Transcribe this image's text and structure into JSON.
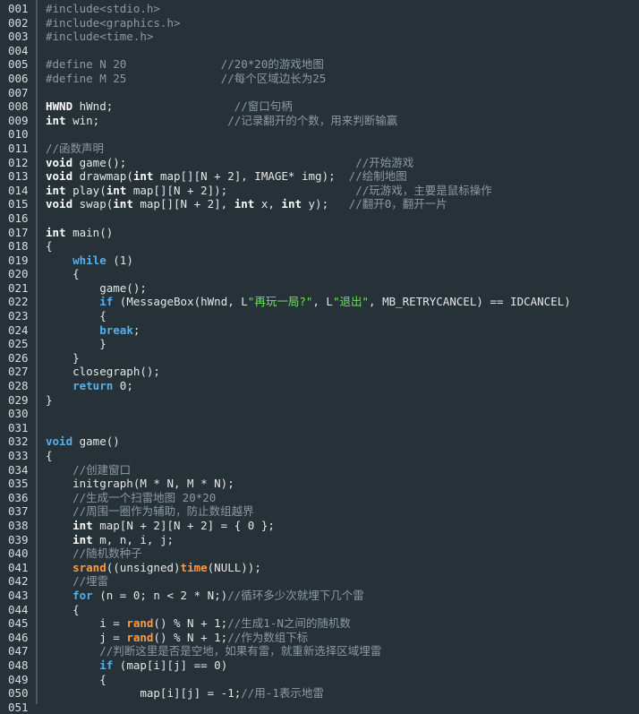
{
  "editor": {
    "background": "#263238",
    "colors": {
      "default": "#e6e6e6",
      "keyword": "#ffffff",
      "control_keyword": "#53b0ef",
      "function": "#ff9a3c",
      "comment": "#8c9a9f",
      "string": "#6fe05c",
      "line_number": "#d8dee0"
    },
    "lines": [
      {
        "num": "001",
        "tokens": [
          [
            "pre",
            "#include<stdio.h>"
          ]
        ]
      },
      {
        "num": "002",
        "tokens": [
          [
            "pre",
            "#include<graphics.h>"
          ]
        ]
      },
      {
        "num": "003",
        "tokens": [
          [
            "pre",
            "#include<time.h>"
          ]
        ]
      },
      {
        "num": "004",
        "tokens": []
      },
      {
        "num": "005",
        "tokens": [
          [
            "pre",
            "#define N 20              "
          ],
          [
            "com",
            "//20*20的游戏地图"
          ]
        ]
      },
      {
        "num": "006",
        "tokens": [
          [
            "pre",
            "#define M 25              "
          ],
          [
            "com",
            "//每个区域边长为25"
          ]
        ]
      },
      {
        "num": "007",
        "tokens": []
      },
      {
        "num": "008",
        "tokens": [
          [
            "kw",
            "HWND"
          ],
          [
            "default",
            " hWnd;                  "
          ],
          [
            "com",
            "//窗口句柄"
          ]
        ]
      },
      {
        "num": "009",
        "tokens": [
          [
            "kw",
            "int"
          ],
          [
            "default",
            " win;                   "
          ],
          [
            "com",
            "//记录翻开的个数，用来判断输赢"
          ]
        ]
      },
      {
        "num": "010",
        "tokens": []
      },
      {
        "num": "011",
        "tokens": [
          [
            "com",
            "//函数声明"
          ]
        ]
      },
      {
        "num": "012",
        "tokens": [
          [
            "kw",
            "void"
          ],
          [
            "default",
            " game();                                  "
          ],
          [
            "com",
            "//开始游戏"
          ]
        ]
      },
      {
        "num": "013",
        "tokens": [
          [
            "kw",
            "void"
          ],
          [
            "default",
            " drawmap("
          ],
          [
            "kw",
            "int"
          ],
          [
            "default",
            " map[][N + 2], IMAGE* img);  "
          ],
          [
            "com",
            "//绘制地图"
          ]
        ]
      },
      {
        "num": "014",
        "tokens": [
          [
            "kw",
            "int"
          ],
          [
            "default",
            " play("
          ],
          [
            "kw",
            "int"
          ],
          [
            "default",
            " map[][N + 2]);                   "
          ],
          [
            "com",
            "//玩游戏，主要是鼠标操作"
          ]
        ]
      },
      {
        "num": "015",
        "tokens": [
          [
            "kw",
            "void"
          ],
          [
            "default",
            " swap("
          ],
          [
            "kw",
            "int"
          ],
          [
            "default",
            " map[][N + 2], "
          ],
          [
            "kw",
            "int"
          ],
          [
            "default",
            " x, "
          ],
          [
            "kw",
            "int"
          ],
          [
            "default",
            " y);   "
          ],
          [
            "com",
            "//翻开0，翻开一片"
          ]
        ]
      },
      {
        "num": "016",
        "tokens": []
      },
      {
        "num": "017",
        "tokens": [
          [
            "kw",
            "int"
          ],
          [
            "default",
            " main()"
          ]
        ]
      },
      {
        "num": "018",
        "tokens": [
          [
            "default",
            "{"
          ]
        ]
      },
      {
        "num": "019",
        "tokens": [
          [
            "default",
            "    "
          ],
          [
            "kw2",
            "while"
          ],
          [
            "default",
            " (1)"
          ]
        ]
      },
      {
        "num": "020",
        "tokens": [
          [
            "default",
            "    {"
          ]
        ]
      },
      {
        "num": "021",
        "tokens": [
          [
            "default",
            "        game();"
          ]
        ]
      },
      {
        "num": "022",
        "tokens": [
          [
            "default",
            "        "
          ],
          [
            "kw2",
            "if"
          ],
          [
            "default",
            " (MessageBox(hWnd, L"
          ],
          [
            "str",
            "\"再玩一局?\""
          ],
          [
            "default",
            ", L"
          ],
          [
            "str",
            "\"退出\""
          ],
          [
            "default",
            ", MB_RETRYCANCEL) == IDCANCEL)"
          ]
        ]
      },
      {
        "num": "023",
        "tokens": [
          [
            "default",
            "        {"
          ]
        ]
      },
      {
        "num": "024",
        "tokens": [
          [
            "default",
            "        "
          ],
          [
            "kw2",
            "break"
          ],
          [
            "default",
            ";"
          ]
        ]
      },
      {
        "num": "025",
        "tokens": [
          [
            "default",
            "        }"
          ]
        ]
      },
      {
        "num": "026",
        "tokens": [
          [
            "default",
            "    }"
          ]
        ]
      },
      {
        "num": "027",
        "tokens": [
          [
            "default",
            "    closegraph();"
          ]
        ]
      },
      {
        "num": "028",
        "tokens": [
          [
            "default",
            "    "
          ],
          [
            "kw2",
            "return"
          ],
          [
            "default",
            " 0;"
          ]
        ]
      },
      {
        "num": "029",
        "tokens": [
          [
            "default",
            "}"
          ]
        ]
      },
      {
        "num": "030",
        "tokens": []
      },
      {
        "num": "031",
        "tokens": []
      },
      {
        "num": "032",
        "tokens": [
          [
            "kw2",
            "void"
          ],
          [
            "default",
            " game()"
          ]
        ]
      },
      {
        "num": "033",
        "tokens": [
          [
            "default",
            "{"
          ]
        ]
      },
      {
        "num": "034",
        "tokens": [
          [
            "default",
            "    "
          ],
          [
            "com",
            "//创建窗口"
          ]
        ]
      },
      {
        "num": "035",
        "tokens": [
          [
            "default",
            "    initgraph(M * N, M * N);"
          ]
        ]
      },
      {
        "num": "036",
        "tokens": [
          [
            "default",
            "    "
          ],
          [
            "com",
            "//生成一个扫雷地图 20*20"
          ]
        ]
      },
      {
        "num": "037",
        "tokens": [
          [
            "default",
            "    "
          ],
          [
            "com",
            "//周围一圈作为辅助，防止数组越界"
          ]
        ]
      },
      {
        "num": "038",
        "tokens": [
          [
            "default",
            "    "
          ],
          [
            "kw",
            "int"
          ],
          [
            "default",
            " map[N + 2][N + 2] = { 0 };"
          ]
        ]
      },
      {
        "num": "039",
        "tokens": [
          [
            "default",
            "    "
          ],
          [
            "kw",
            "int"
          ],
          [
            "default",
            " m, n, i, j;"
          ]
        ]
      },
      {
        "num": "040",
        "tokens": [
          [
            "default",
            "    "
          ],
          [
            "com",
            "//随机数种子"
          ]
        ]
      },
      {
        "num": "041",
        "tokens": [
          [
            "default",
            "    "
          ],
          [
            "fn",
            "srand"
          ],
          [
            "default",
            "((unsigned)"
          ],
          [
            "fn",
            "time"
          ],
          [
            "default",
            "(NULL));"
          ]
        ]
      },
      {
        "num": "042",
        "tokens": [
          [
            "default",
            "    "
          ],
          [
            "com",
            "//埋雷"
          ]
        ]
      },
      {
        "num": "043",
        "tokens": [
          [
            "default",
            "    "
          ],
          [
            "kw2",
            "for"
          ],
          [
            "default",
            " (n = 0; n < 2 * N;)"
          ],
          [
            "com",
            "//循环多少次就埋下几个雷"
          ]
        ]
      },
      {
        "num": "044",
        "tokens": [
          [
            "default",
            "    {"
          ]
        ]
      },
      {
        "num": "045",
        "tokens": [
          [
            "default",
            "        i = "
          ],
          [
            "fn",
            "rand"
          ],
          [
            "default",
            "() % N + 1;"
          ],
          [
            "com",
            "//生成1-N之间的随机数"
          ]
        ]
      },
      {
        "num": "046",
        "tokens": [
          [
            "default",
            "        j = "
          ],
          [
            "fn",
            "rand"
          ],
          [
            "default",
            "() % N + 1;"
          ],
          [
            "com",
            "//作为数组下标"
          ]
        ]
      },
      {
        "num": "047",
        "tokens": [
          [
            "default",
            "        "
          ],
          [
            "com",
            "//判断这里是否是空地，如果有雷，就重新选择区域埋雷"
          ]
        ]
      },
      {
        "num": "048",
        "tokens": [
          [
            "default",
            "        "
          ],
          [
            "kw2",
            "if"
          ],
          [
            "default",
            " (map[i][j] == 0)"
          ]
        ]
      },
      {
        "num": "049",
        "tokens": [
          [
            "default",
            "        {"
          ]
        ]
      },
      {
        "num": "050",
        "tokens": [
          [
            "default",
            "              map[i][j] = -1;"
          ],
          [
            "com",
            "//用-1表示地雷"
          ]
        ]
      },
      {
        "num": "051",
        "tokens": []
      }
    ]
  }
}
